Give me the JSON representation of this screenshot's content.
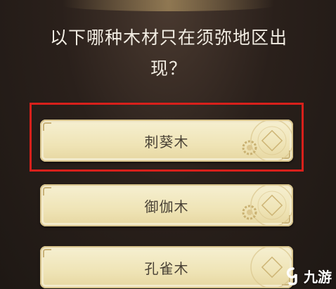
{
  "question": {
    "line1": "以下哪种木材只在须弥地区出",
    "line2": "现？"
  },
  "answers": [
    {
      "label": "刺葵木",
      "highlighted": true
    },
    {
      "label": "御伽木",
      "highlighted": false
    },
    {
      "label": "孔雀木",
      "highlighted": false
    }
  ],
  "highlight_color": "#d8201b",
  "watermark": {
    "text": "九游"
  }
}
